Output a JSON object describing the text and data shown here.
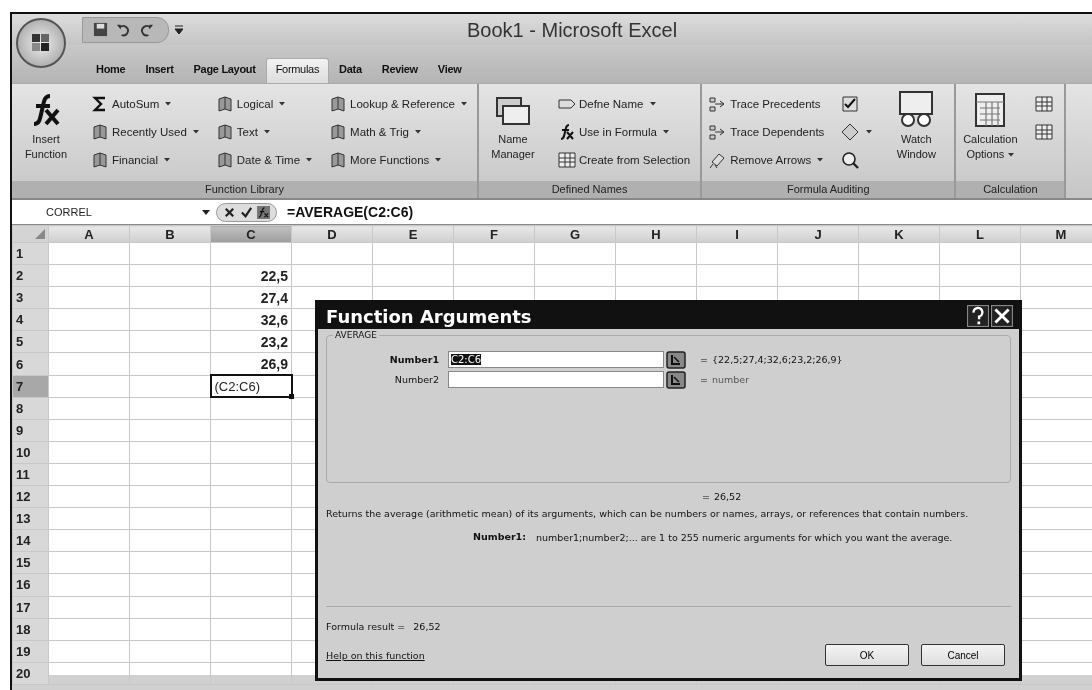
{
  "window": {
    "title": "Book1 - Microsoft Excel"
  },
  "tabs": [
    {
      "label": "Home",
      "selected": false
    },
    {
      "label": "Insert",
      "selected": false
    },
    {
      "label": "Page Layout",
      "selected": false
    },
    {
      "label": "Formulas",
      "selected": true
    },
    {
      "label": "Data",
      "selected": false
    },
    {
      "label": "Review",
      "selected": false
    },
    {
      "label": "View",
      "selected": false
    }
  ],
  "ribbon": {
    "groups": [
      {
        "label": "Function Library",
        "columns": [
          {
            "items": [
              {
                "kind": "large",
                "label": "Insert Function",
                "dropdown": false
              }
            ]
          },
          {
            "items": [
              {
                "kind": "small",
                "label": "AutoSum",
                "dropdown": true
              },
              {
                "kind": "small",
                "label": "Recently Used",
                "dropdown": true
              },
              {
                "kind": "small",
                "label": "Financial",
                "dropdown": true
              }
            ]
          },
          {
            "items": [
              {
                "kind": "small",
                "label": "Logical",
                "dropdown": true
              },
              {
                "kind": "small",
                "label": "Text",
                "dropdown": true
              },
              {
                "kind": "small",
                "label": "Date & Time",
                "dropdown": true
              }
            ]
          },
          {
            "items": [
              {
                "kind": "small",
                "label": "Lookup & Reference",
                "dropdown": true
              },
              {
                "kind": "small",
                "label": "Math & Trig",
                "dropdown": true
              },
              {
                "kind": "small",
                "label": "More Functions",
                "dropdown": true
              }
            ]
          }
        ]
      },
      {
        "label": "Defined Names",
        "columns": [
          {
            "items": [
              {
                "kind": "large",
                "label": "Name Manager",
                "dropdown": false
              }
            ]
          },
          {
            "items": [
              {
                "kind": "small",
                "label": "Defne Name",
                "dropdown": true
              },
              {
                "kind": "small",
                "label": "Use in Formula",
                "dropdown": true
              },
              {
                "kind": "small",
                "label": "Create from Selection",
                "dropdown": false
              }
            ]
          }
        ]
      },
      {
        "label": "Formula Auditing",
        "columns": [
          {
            "items": [
              {
                "kind": "small",
                "label": "Trace Precedents",
                "dropdown": false
              },
              {
                "kind": "small",
                "label": "Trace Dependents",
                "dropdown": false
              },
              {
                "kind": "small",
                "label": "Remove Arrows",
                "dropdown": true
              }
            ]
          },
          {
            "items": [
              {
                "kind": "icon",
                "dropdown": false
              },
              {
                "kind": "icon",
                "dropdown": true
              },
              {
                "kind": "icon",
                "dropdown": false
              }
            ]
          },
          {
            "items": [
              {
                "kind": "large",
                "label": "Watch Window",
                "dropdown": false
              }
            ]
          }
        ]
      },
      {
        "label": "Calculation",
        "columns": [
          {
            "items": [
              {
                "kind": "large",
                "label": "Calculation Options",
                "dropdown": true
              }
            ]
          },
          {
            "items": [
              {
                "kind": "icon",
                "dropdown": false
              },
              {
                "kind": "icon",
                "dropdown": false
              }
            ]
          }
        ]
      }
    ]
  },
  "formula_bar": {
    "name_box": "CORREL",
    "formula": "=AVERAGE(C2:C6)"
  },
  "sheet": {
    "columns": [
      {
        "label": "A",
        "selected": false
      },
      {
        "label": "B",
        "selected": false
      },
      {
        "label": "C",
        "selected": true
      },
      {
        "label": "D",
        "selected": false
      },
      {
        "label": "E",
        "selected": false
      },
      {
        "label": "F",
        "selected": false
      },
      {
        "label": "G",
        "selected": false
      },
      {
        "label": "H",
        "selected": false
      },
      {
        "label": "I",
        "selected": false
      },
      {
        "label": "J",
        "selected": false
      },
      {
        "label": "K",
        "selected": false
      },
      {
        "label": "L",
        "selected": false
      },
      {
        "label": "M",
        "selected": false
      }
    ],
    "rows": [
      {
        "header": "1",
        "selected": false,
        "cells": []
      },
      {
        "header": "2",
        "selected": false,
        "cells": [
          null,
          null,
          {
            "text": "22,5",
            "kind": "number",
            "selected": false
          }
        ]
      },
      {
        "header": "3",
        "selected": false,
        "cells": [
          null,
          null,
          {
            "text": "27,4",
            "kind": "number",
            "selected": false
          }
        ]
      },
      {
        "header": "4",
        "selected": false,
        "cells": [
          null,
          null,
          {
            "text": "32,6",
            "kind": "number",
            "selected": false
          }
        ]
      },
      {
        "header": "5",
        "selected": false,
        "cells": [
          null,
          null,
          {
            "text": "23,2",
            "kind": "number",
            "selected": false
          }
        ]
      },
      {
        "header": "6",
        "selected": false,
        "cells": [
          null,
          null,
          {
            "text": "26,9",
            "kind": "number",
            "selected": false
          }
        ]
      },
      {
        "header": "7",
        "selected": true,
        "cells": [
          null,
          null,
          {
            "text": "(C2:C6)",
            "kind": "text",
            "selected": true
          }
        ]
      },
      {
        "header": "8",
        "selected": false,
        "cells": []
      },
      {
        "header": "9",
        "selected": false,
        "cells": []
      },
      {
        "header": "10",
        "selected": false,
        "cells": []
      },
      {
        "header": "11",
        "selected": false,
        "cells": []
      },
      {
        "header": "12",
        "selected": false,
        "cells": []
      },
      {
        "header": "13",
        "selected": false,
        "cells": []
      },
      {
        "header": "14",
        "selected": false,
        "cells": []
      },
      {
        "header": "15",
        "selected": false,
        "cells": []
      },
      {
        "header": "16",
        "selected": false,
        "cells": []
      },
      {
        "header": "17",
        "selected": false,
        "cells": []
      },
      {
        "header": "18",
        "selected": false,
        "cells": []
      },
      {
        "header": "19",
        "selected": false,
        "cells": []
      },
      {
        "header": "20",
        "selected": false,
        "cells": []
      }
    ]
  },
  "dialog": {
    "title": "Function Arguments",
    "function_name": "AVERAGE",
    "arguments": [
      {
        "label": "Number1",
        "value": "C2:C6",
        "selected": true,
        "equals": "=",
        "result": "{22,5;27,4;32,6;23,2;26,9}",
        "kind": "value"
      },
      {
        "label": "Number2",
        "selected": false,
        "equals": "=",
        "result": "number",
        "kind": "hint"
      }
    ],
    "result_equals": "=",
    "result": "26,52",
    "description": "Returns the average (arithmetic mean) of its arguments, which can be numbers or names, arrays, or references that contain numbers.",
    "argument_help": {
      "label": "Number1:",
      "text": "number1;number2;... are 1 to 255 numeric arguments for which you want the average."
    },
    "formula_result_label": "Formula result =",
    "formula_result": "26,52",
    "help_link": "Help on this function",
    "buttons": [
      "OK",
      "Cancel"
    ]
  }
}
